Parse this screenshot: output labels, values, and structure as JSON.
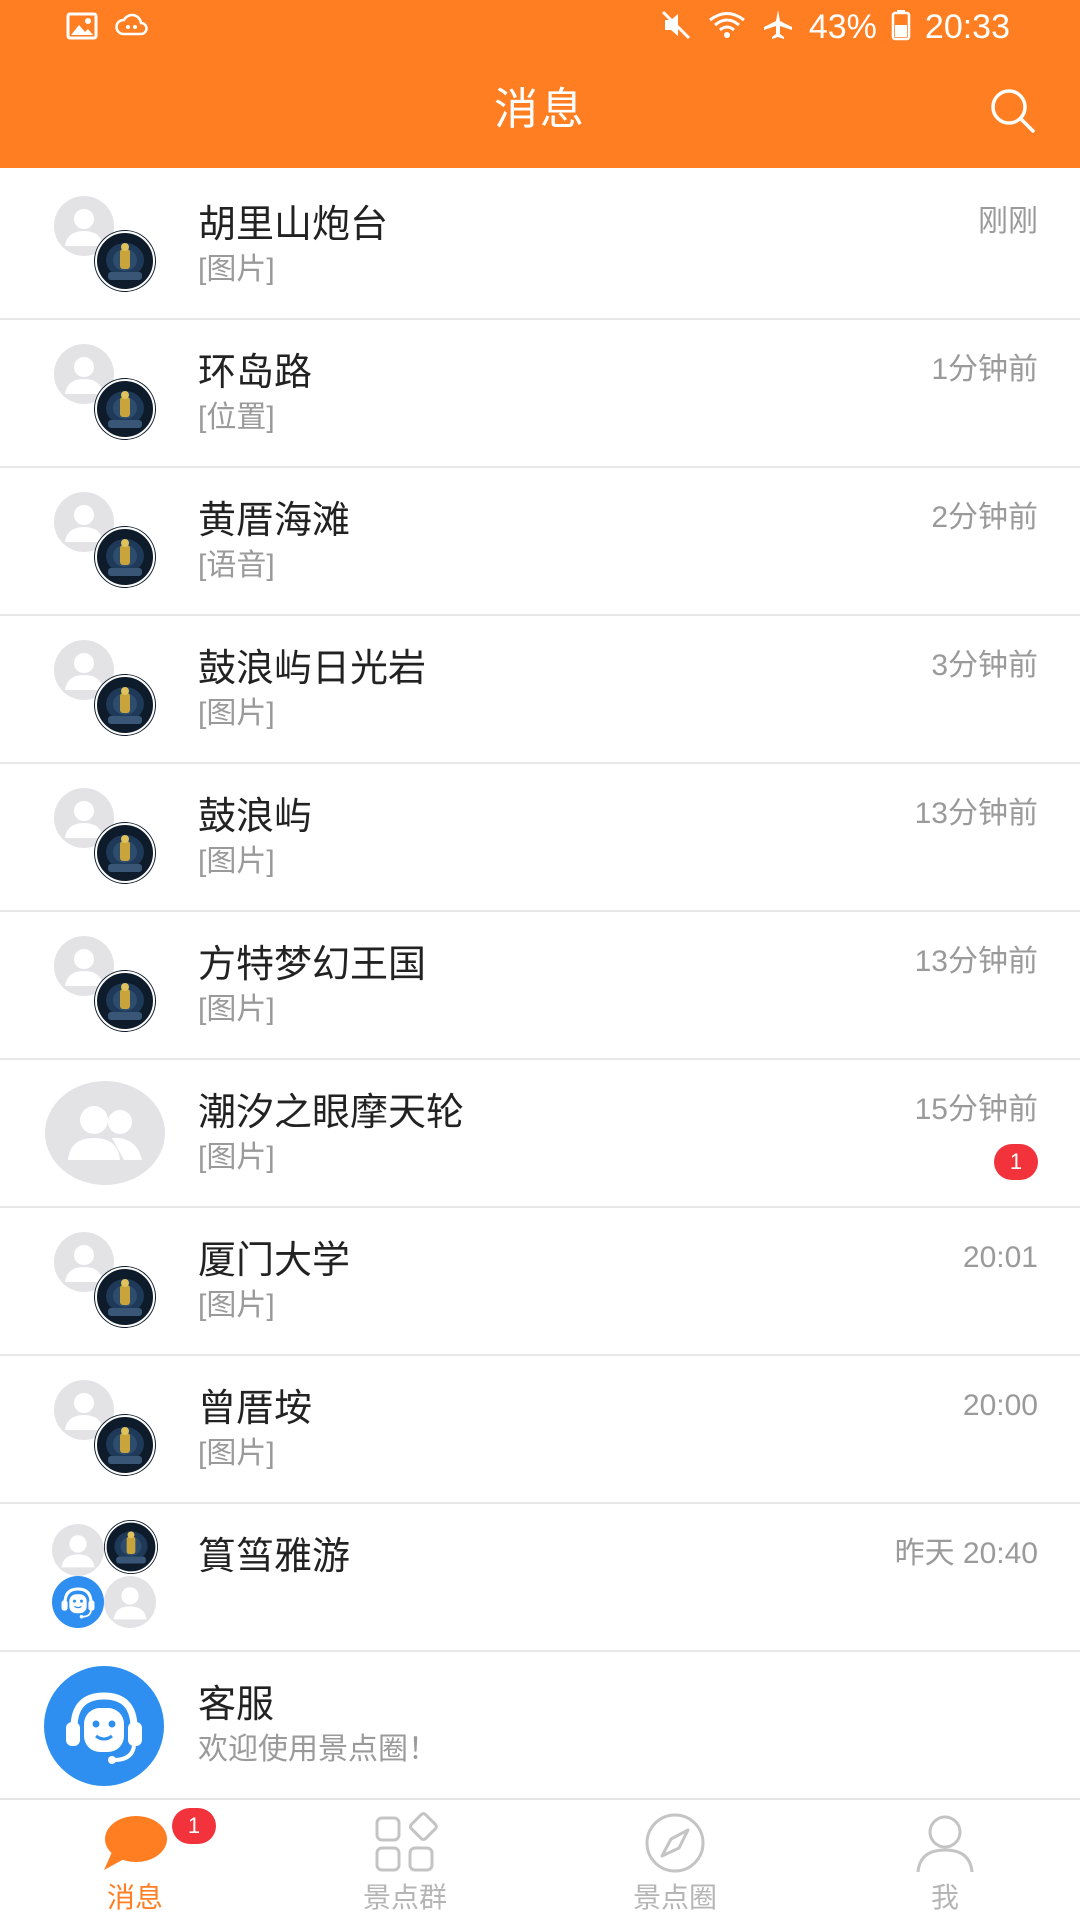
{
  "status_bar": {
    "battery": "43%",
    "time": "20:33",
    "left_icons": [
      "image-icon",
      "cloud-sync-icon"
    ],
    "right_icons": [
      "mute-icon",
      "wifi-icon",
      "airplane-icon",
      "battery-icon"
    ]
  },
  "header": {
    "title": "消息",
    "search_icon": "search-icon"
  },
  "conversations": [
    {
      "name": "胡里山炮台",
      "preview": "[图片]",
      "time": "刚刚",
      "avatar": "group-pair"
    },
    {
      "name": "环岛路",
      "preview": "[位置]",
      "time": "1分钟前",
      "avatar": "group-pair"
    },
    {
      "name": "黄厝海滩",
      "preview": "[语音]",
      "time": "2分钟前",
      "avatar": "group-pair"
    },
    {
      "name": "鼓浪屿日光岩",
      "preview": "[图片]",
      "time": "3分钟前",
      "avatar": "group-pair"
    },
    {
      "name": "鼓浪屿",
      "preview": "[图片]",
      "time": "13分钟前",
      "avatar": "group-pair"
    },
    {
      "name": "方特梦幻王国",
      "preview": "[图片]",
      "time": "13分钟前",
      "avatar": "group-pair"
    },
    {
      "name": "潮汐之眼摩天轮",
      "preview": "[图片]",
      "time": "15分钟前",
      "avatar": "group-default",
      "unread": "1"
    },
    {
      "name": "厦门大学",
      "preview": "[图片]",
      "time": "20:01",
      "avatar": "group-pair"
    },
    {
      "name": "曾厝垵",
      "preview": "[图片]",
      "time": "20:00",
      "avatar": "group-pair"
    },
    {
      "name": "篔筜雅游",
      "preview": "",
      "time": "昨天 20:40",
      "avatar": "group-quad"
    },
    {
      "name": "客服",
      "preview": "欢迎使用景点圈！",
      "time": "",
      "avatar": "support"
    }
  ],
  "tabs": [
    {
      "label": "消息",
      "icon": "chat-bubble-icon",
      "active": true,
      "badge": "1"
    },
    {
      "label": "景点群",
      "icon": "grid-icon",
      "active": false
    },
    {
      "label": "景点圈",
      "icon": "compass-icon",
      "active": false
    },
    {
      "label": "我",
      "icon": "person-icon",
      "active": false
    }
  ],
  "colors": {
    "brand": "#ff7e22",
    "badge": "#f2333b",
    "support_blue": "#2e8ff0",
    "muted_text": "#9a9a9a"
  }
}
